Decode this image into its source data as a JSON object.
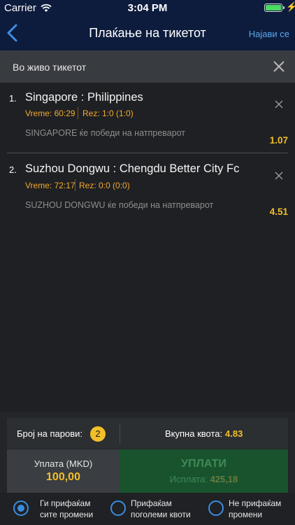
{
  "status_bar": {
    "carrier": "Carrier",
    "time": "3:04 PM"
  },
  "nav": {
    "title": "Плаќање на тикетот",
    "login": "Најави се"
  },
  "section": {
    "title": "Во живо тикетот"
  },
  "bets": [
    {
      "num": "1.",
      "match": "Singapore : Philippines",
      "time": "Vreme:  60:29",
      "score": "Rez: 1:0 (1:0)",
      "pick": "SINGAPORE ќе победи на натпреварот",
      "odd": "1.07"
    },
    {
      "num": "2.",
      "match": "Suzhou Dongwu : Chengdu Better City Fc",
      "time": "Vreme:  72:17",
      "score": "Rez: 0:0 (0:0)",
      "pick": "SUZHOU DONGWU ќе победи на натпреварот",
      "odd": "4.51"
    }
  ],
  "summary": {
    "pairs_label": "Број на парови:",
    "pairs_count": "2",
    "total_label": "Вкупна квота:",
    "total_value": "4.83"
  },
  "stake": {
    "label": "Уплата (MKD)",
    "value": "100,00"
  },
  "pay": {
    "label": "УПЛАТИ",
    "payout_label": "Исплата:",
    "payout_value": "425,18"
  },
  "options": [
    {
      "line1": "Ги прифаќам",
      "line2": "сите промени",
      "selected": true
    },
    {
      "line1": "Прифаќам",
      "line2": "поголеми квоти",
      "selected": false
    },
    {
      "line1": "Не прифаќам",
      "line2": "промени",
      "selected": false
    }
  ],
  "colors": {
    "nav_bg": "#0d1c3d",
    "accent": "#f2bf2a",
    "link": "#5aa8ea",
    "pay_bg": "#18532e",
    "radio": "#3b8ce0"
  }
}
